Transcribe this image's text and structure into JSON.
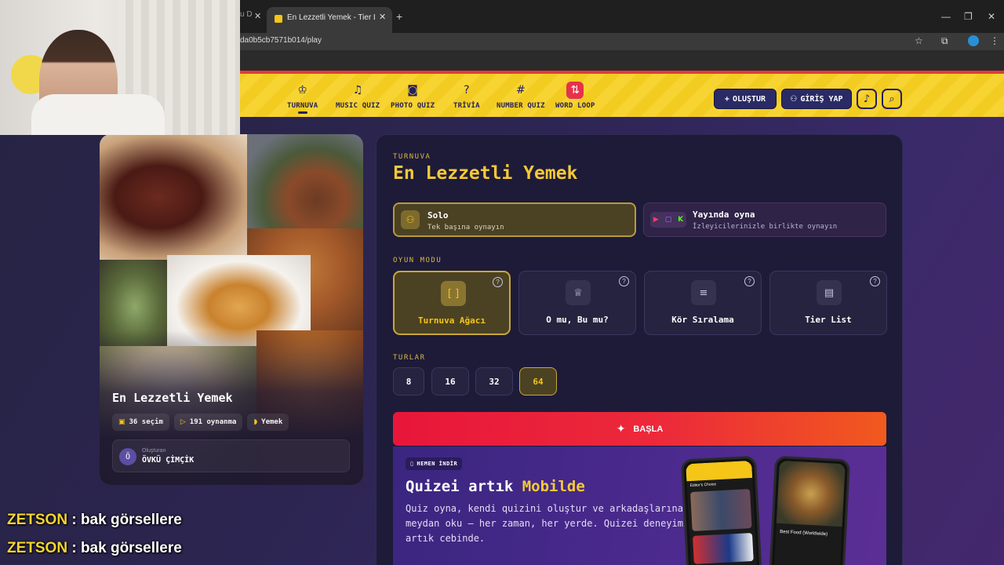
{
  "browser": {
    "prev_tab_fragment": "u D",
    "active_tab_title": "En Lezzetli Yemek - Tier List, Kö",
    "url_fragment": "da0b5cb7571b014/play"
  },
  "nav": {
    "items": [
      {
        "label": "TURNUVA",
        "icon": "trophy-icon"
      },
      {
        "label": "MUSIC QUIZ",
        "icon": "music-icon"
      },
      {
        "label": "PHOTO QUIZ",
        "icon": "camera-icon"
      },
      {
        "label": "TRİVİA",
        "icon": "question-icon"
      },
      {
        "label": "NUMBER QUIZ",
        "icon": "hash-icon"
      },
      {
        "label": "WORD LOOP",
        "icon": "word-loop-icon"
      }
    ],
    "create_label": "OLUŞTUR",
    "login_label": "GİRİŞ YAP"
  },
  "card": {
    "title": "En Lezzetli Yemek",
    "selections": "36 seçim",
    "plays": "191 oynanma",
    "category": "Yemek",
    "creator_label": "Oluşturan",
    "creator_initial": "Ö",
    "creator_name": "ÖVKÜ ÇİMÇİK"
  },
  "panel": {
    "kicker": "TURNUVA",
    "title": "En Lezzetli Yemek",
    "solo_title": "Solo",
    "solo_sub": "Tek başına oynayın",
    "stream_title": "Yayında oyna",
    "stream_sub": "İzleyicilerinizle birlikte oynayın",
    "mode_label": "OYUN MODU",
    "modes": [
      "Turnuva Ağacı",
      "O mu, Bu mu?",
      "Kör Sıralama",
      "Tier List"
    ],
    "rounds_label": "TURLAR",
    "rounds": [
      "8",
      "16",
      "32",
      "64"
    ],
    "selected_round": "64",
    "start_label": "BAŞLA"
  },
  "promo": {
    "badge": "HEMEN İNDİR",
    "title_a": "Quizei artık ",
    "title_b": "Mobilde",
    "text": "Quiz oyna, kendi quizini oluştur ve arkadaşlarına meydan oku — her zaman, her yerde. Quizei deneyimi artık cebinde.",
    "phone_left_header": "Editor's Choice",
    "phone_right_caption": "Best Food (Worldwide)"
  },
  "chat": [
    {
      "user": "ZETSON",
      "message": "bak görsellere"
    },
    {
      "user": "ZETSON",
      "message": "bak görsellere"
    }
  ],
  "colors": {
    "accent_yellow": "#f6c937",
    "nav_bg": "#f7d432",
    "start_red": "#e8163a",
    "panel_bg": "#1d1b38"
  }
}
